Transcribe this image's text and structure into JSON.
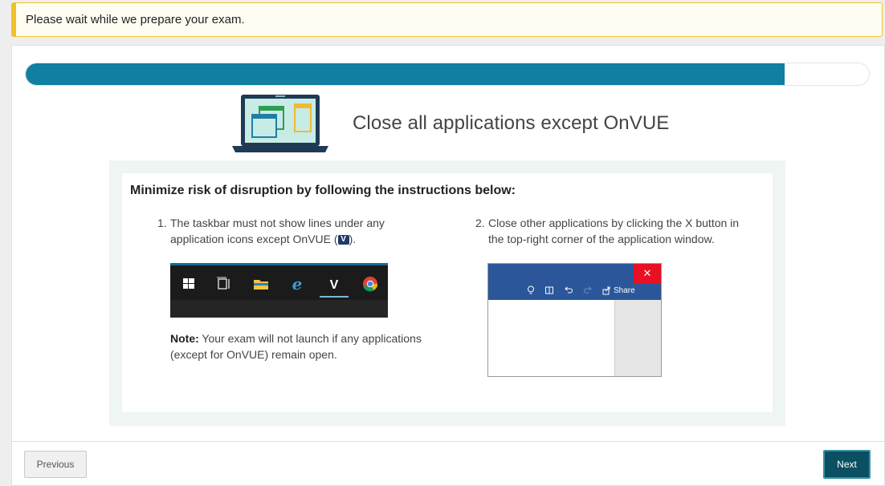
{
  "alert": {
    "text": "Please wait while we prepare your exam."
  },
  "progress": {
    "fraction": 0.9
  },
  "hero": {
    "title": "Close all applications except OnVUE",
    "icon": "laptop-windows-icon"
  },
  "instructions": {
    "heading": "Minimize risk of disruption by following the instructions below:",
    "step1": {
      "number": "1.",
      "text_before": "The taskbar must not show lines under any application icons except OnVUE (",
      "badge": "V",
      "text_after": ")."
    },
    "step2": {
      "number": "2.",
      "text": "Close other applications by clicking the X button in the top-right corner of the application window."
    },
    "note": {
      "label": "Note:",
      "text": " Your exam will not launch if any applications (except for OnVUE) remain open."
    },
    "taskbar_icons": [
      "windows-start-icon",
      "task-view-icon",
      "file-explorer-icon",
      "internet-explorer-icon",
      "onvue-icon",
      "chrome-icon"
    ],
    "window_example": {
      "close_glyph": "✕",
      "share_label": "Share"
    }
  },
  "footer": {
    "previous_label": "Previous",
    "next_label": "Next"
  },
  "colors": {
    "accent": "#107fa1",
    "alert_border": "#f1c12a",
    "next_button": "#0b4f63",
    "close_red": "#e81123"
  }
}
